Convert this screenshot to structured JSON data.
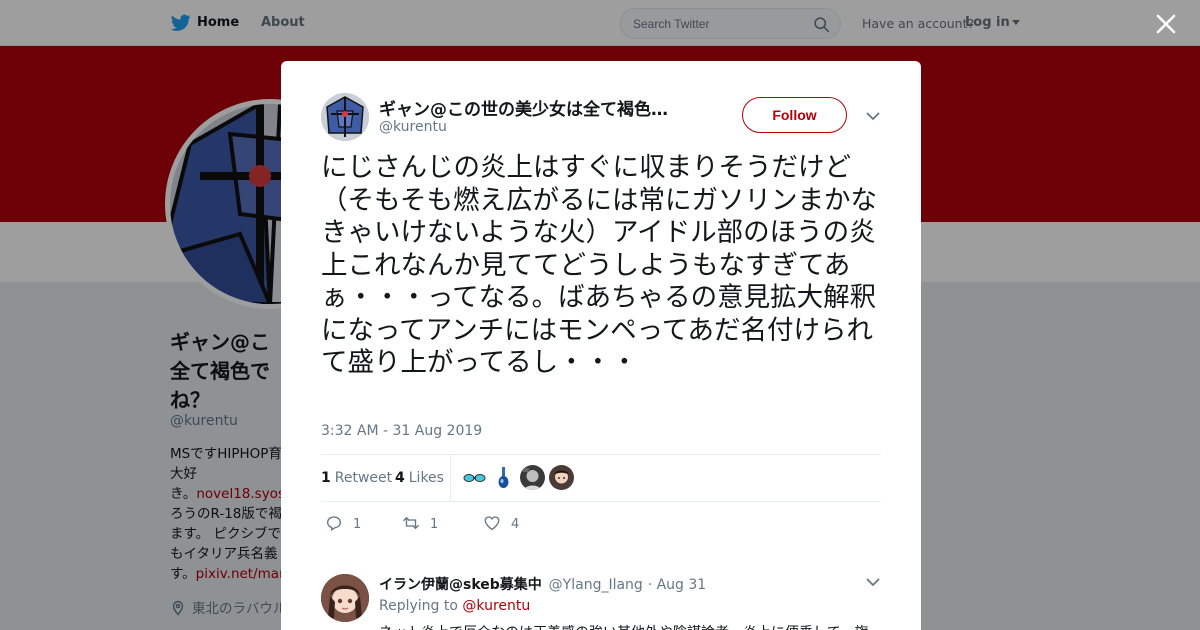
{
  "nav": {
    "home_label": "Home",
    "about_label": "About",
    "search_placeholder": "Search Twitter",
    "have_account": "Have an account?",
    "login_label": "Log in"
  },
  "profile": {
    "name": "ギャン@この世の美少女は全て褐色でいいですよね？",
    "name_visible_lines": [
      "ギャン@こ",
      "全て褐色で",
      "ね？"
    ],
    "handle": "@kurentu",
    "bio_lines": [
      {
        "text": "MSですHIPHOP育"
      },
      {
        "text": "大好"
      },
      {
        "text": "き。",
        "link": "novel18.syos"
      },
      {
        "text": "ろうのR-18版で褐"
      },
      {
        "text": "ます。 ピクシブで"
      },
      {
        "text": "もイタリア兵名義"
      },
      {
        "text": "す。",
        "link": "pixiv.net/man"
      }
    ],
    "location": "東北のラバウル"
  },
  "tweet": {
    "author_name": "ギャン@この世の美少女は全て褐色…",
    "author_handle": "@kurentu",
    "follow_label": "Follow",
    "text": "にじさんじの炎上はすぐに収まりそうだけど（そもそも燃え広がるには常にガソリンまかなきゃいけないような火）アイドル部のほうの炎上これなんか見ててどうしようもなすぎてあぁ・・・ってなる。ばあちゃるの意見拡大解釈になってアンチにはモンペってあだ名付けられて盛り上がってるし・・・",
    "timestamp": "3:32 AM - 31 Aug 2019",
    "retweets_count": "1",
    "retweets_label": "Retweet",
    "likes_count": "4",
    "likes_label": "Likes",
    "actions": {
      "reply_count": "1",
      "retweet_count": "1",
      "like_count": "4"
    }
  },
  "reply": {
    "name": "イラン伊蘭@skeb募集中",
    "handle": "@Ylang_Ilang",
    "date": "· Aug 31",
    "replying_prefix": "Replying to",
    "replying_to": "@kurentu",
    "text_visible": "ネット炎上で厄介なのは正義感の強い其他外や陰謀論者、炎上に便乗して一旗"
  },
  "colors": {
    "brand": "#b1000a",
    "twitter_blue": "#1da1f2",
    "muted_text": "#657786"
  },
  "icons": [
    "twitter-bird-icon",
    "search-icon",
    "close-icon",
    "chevron-down-icon",
    "pin-icon",
    "reply-icon",
    "retweet-icon",
    "heart-icon"
  ]
}
